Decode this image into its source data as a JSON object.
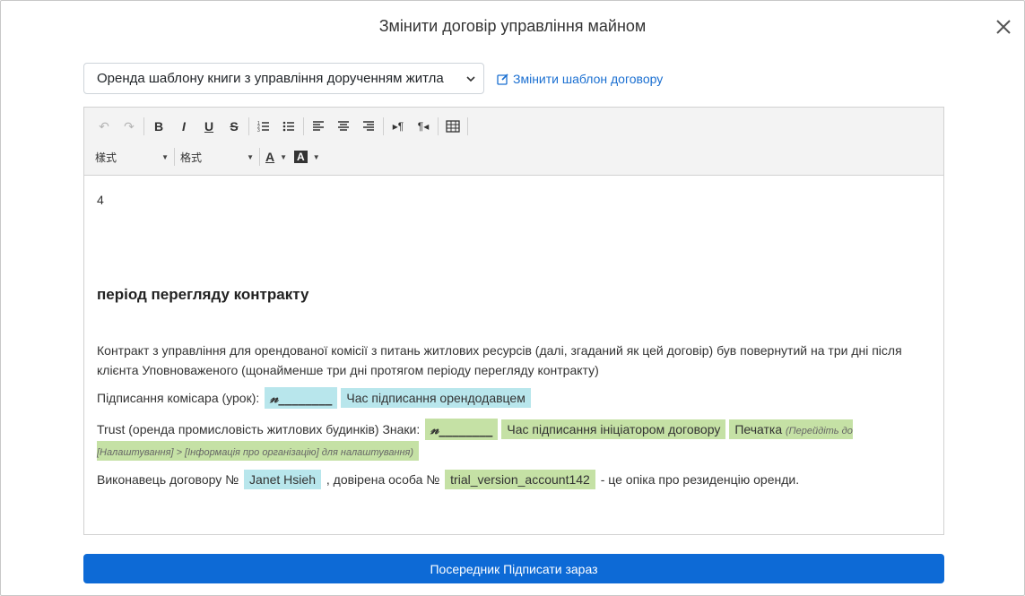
{
  "modal": {
    "title": "Змінити договір управління майном",
    "close_icon": "close-icon"
  },
  "template": {
    "selected": "Оренда шаблону книги з управління дорученням житла",
    "change_link": "Змінити шаблон договору"
  },
  "toolbar": {
    "font_style": "樣式",
    "format": "格式"
  },
  "document": {
    "number": "4",
    "heading": "період перегляду контракту",
    "paragraph": "Контракт з управління для орендованої комісії з питань житлових ресурсів (далі, згаданий як цей договір) був повернутий на три дні після клієнта Уповноваженого (щонайменше три дні протягом періоду перегляду контракту)",
    "line1": {
      "label": "Підписання комісара (урок):",
      "signature": "𝓃________",
      "time": "Час підписання орендодавцем"
    },
    "line2": {
      "label": "Trust (оренда промисловість житлових будинків) Знаки:",
      "signature": "𝓃________",
      "time": "Час підписання ініціатором договору",
      "stamp": "Печатка",
      "stamp_note": "(Перейдіть до [Налаштування] > [Інформація про організацію] для налаштування)"
    },
    "line3": {
      "prefix": "Виконавець договору №",
      "contractor": "Janet Hsieh",
      "middle": ", довірена особа №",
      "account": "trial_version_account142",
      "suffix": "- це опіка про резиденцію оренди."
    }
  },
  "sign_button": "Посередник Підписати зараз"
}
